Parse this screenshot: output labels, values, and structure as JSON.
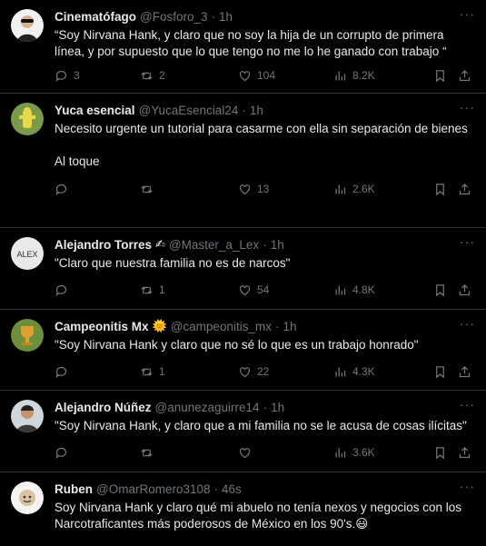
{
  "tweets": [
    {
      "name": "Cinematófago",
      "emoji": "",
      "handle": "@Fosforo_3",
      "dot": "·",
      "time": "1h",
      "text": "“Soy Nirvana Hank, y claro que no soy la hija  de un corrupto de primera línea, y por supuesto que lo que tengo no me lo he ganado con trabajo “",
      "replies": "3",
      "retweets": "2",
      "likes": "104",
      "views": "8.2K",
      "avatar_icon": "man-with-sunglasses-avatar"
    },
    {
      "name": "Yuca esencial",
      "emoji": "",
      "handle": "@YucaEsencial24",
      "dot": "·",
      "time": "1h",
      "text": "Necesito urgente un tutorial para casarme con ella sin separación de bienes\n\nAl toque",
      "replies": "",
      "retweets": "",
      "likes": "13",
      "views": "2.6K",
      "avatar_icon": "yellow-figure-avatar"
    },
    {
      "name": "Alejandro Torres",
      "emoji": "✍",
      "handle": "@Master_a_Lex",
      "dot": "·",
      "time": "1h",
      "text": "\"Claro que nuestra familia no es de narcos\"",
      "replies": "",
      "retweets": "1",
      "likes": "54",
      "views": "4.8K",
      "avatar_icon": "alex-logo-avatar",
      "avatar_text": "ALEX"
    },
    {
      "name": "Campeonitis Mx",
      "emoji": "🌞",
      "handle": "@campeonitis_mx",
      "dot": "·",
      "time": "1h",
      "text": "\"Soy Nirvana Hank y claro que no sé lo que es un trabajo honrado\"",
      "replies": "",
      "retweets": "1",
      "likes": "22",
      "views": "4.3K",
      "avatar_icon": "trophy-avatar"
    },
    {
      "name": "Alejandro Núñez",
      "emoji": "",
      "handle": "@anunezaguirre14",
      "dot": "·",
      "time": "1h",
      "text": "\"Soy Nirvana Hank, y claro que a mi familia no se le acusa de cosas ilícitas\"",
      "replies": "",
      "retweets": "",
      "likes": "",
      "views": "3.6K",
      "avatar_icon": "man-portrait-avatar"
    },
    {
      "name": "Ruben",
      "emoji": "",
      "handle": "@OmarRomero3108",
      "dot": "·",
      "time": "46s",
      "text": "Soy Nirvana Hank y claro qué mi abuelo no tenía nexos y negocios con los Narcotraficantes más poderosos de México en los 90's.😃",
      "replies": "",
      "retweets": "",
      "likes": "",
      "views": "",
      "avatar_icon": "cartoon-face-avatar"
    }
  ],
  "more_glyph": "···",
  "colors": {
    "background": "#000000",
    "text": "#e7e9ea",
    "muted": "#71767b",
    "divider": "#2f3336"
  }
}
